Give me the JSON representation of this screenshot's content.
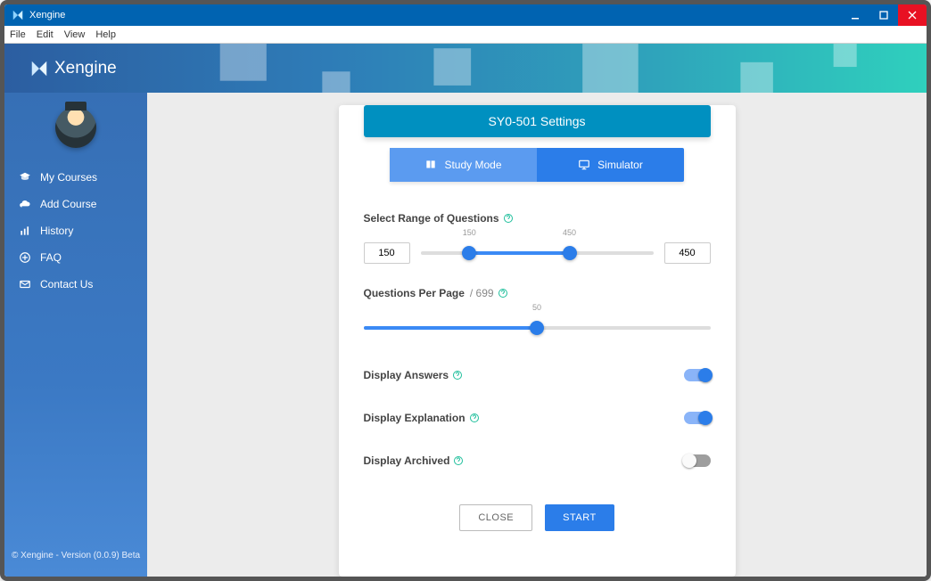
{
  "window": {
    "title": "Xengine",
    "menu": [
      "File",
      "Edit",
      "View",
      "Help"
    ]
  },
  "brand": {
    "name": "Xengine"
  },
  "sidebar": {
    "items": [
      {
        "label": "My Courses"
      },
      {
        "label": "Add Course"
      },
      {
        "label": "History"
      },
      {
        "label": "FAQ"
      },
      {
        "label": "Contact Us"
      }
    ],
    "footer": "© Xengine - Version (0.0.9) Beta"
  },
  "settings": {
    "title": "SY0-501 Settings",
    "tabs": {
      "study": "Study Mode",
      "simulator": "Simulator",
      "active": "study"
    },
    "range": {
      "label": "Select Range of Questions",
      "low": "150",
      "high": "450",
      "lowTip": "150",
      "highTip": "450",
      "min": 0,
      "max": 699
    },
    "perPage": {
      "label": "Questions Per Page",
      "total": "/ 699",
      "value": "50",
      "max": 100
    },
    "toggles": {
      "answers": {
        "label": "Display Answers",
        "on": true
      },
      "explanation": {
        "label": "Display Explanation",
        "on": true
      },
      "archived": {
        "label": "Display Archived",
        "on": false
      }
    },
    "buttons": {
      "close": "CLOSE",
      "start": "START"
    }
  },
  "colors": {
    "accent": "#2b7de9",
    "header": "#0090c0"
  }
}
